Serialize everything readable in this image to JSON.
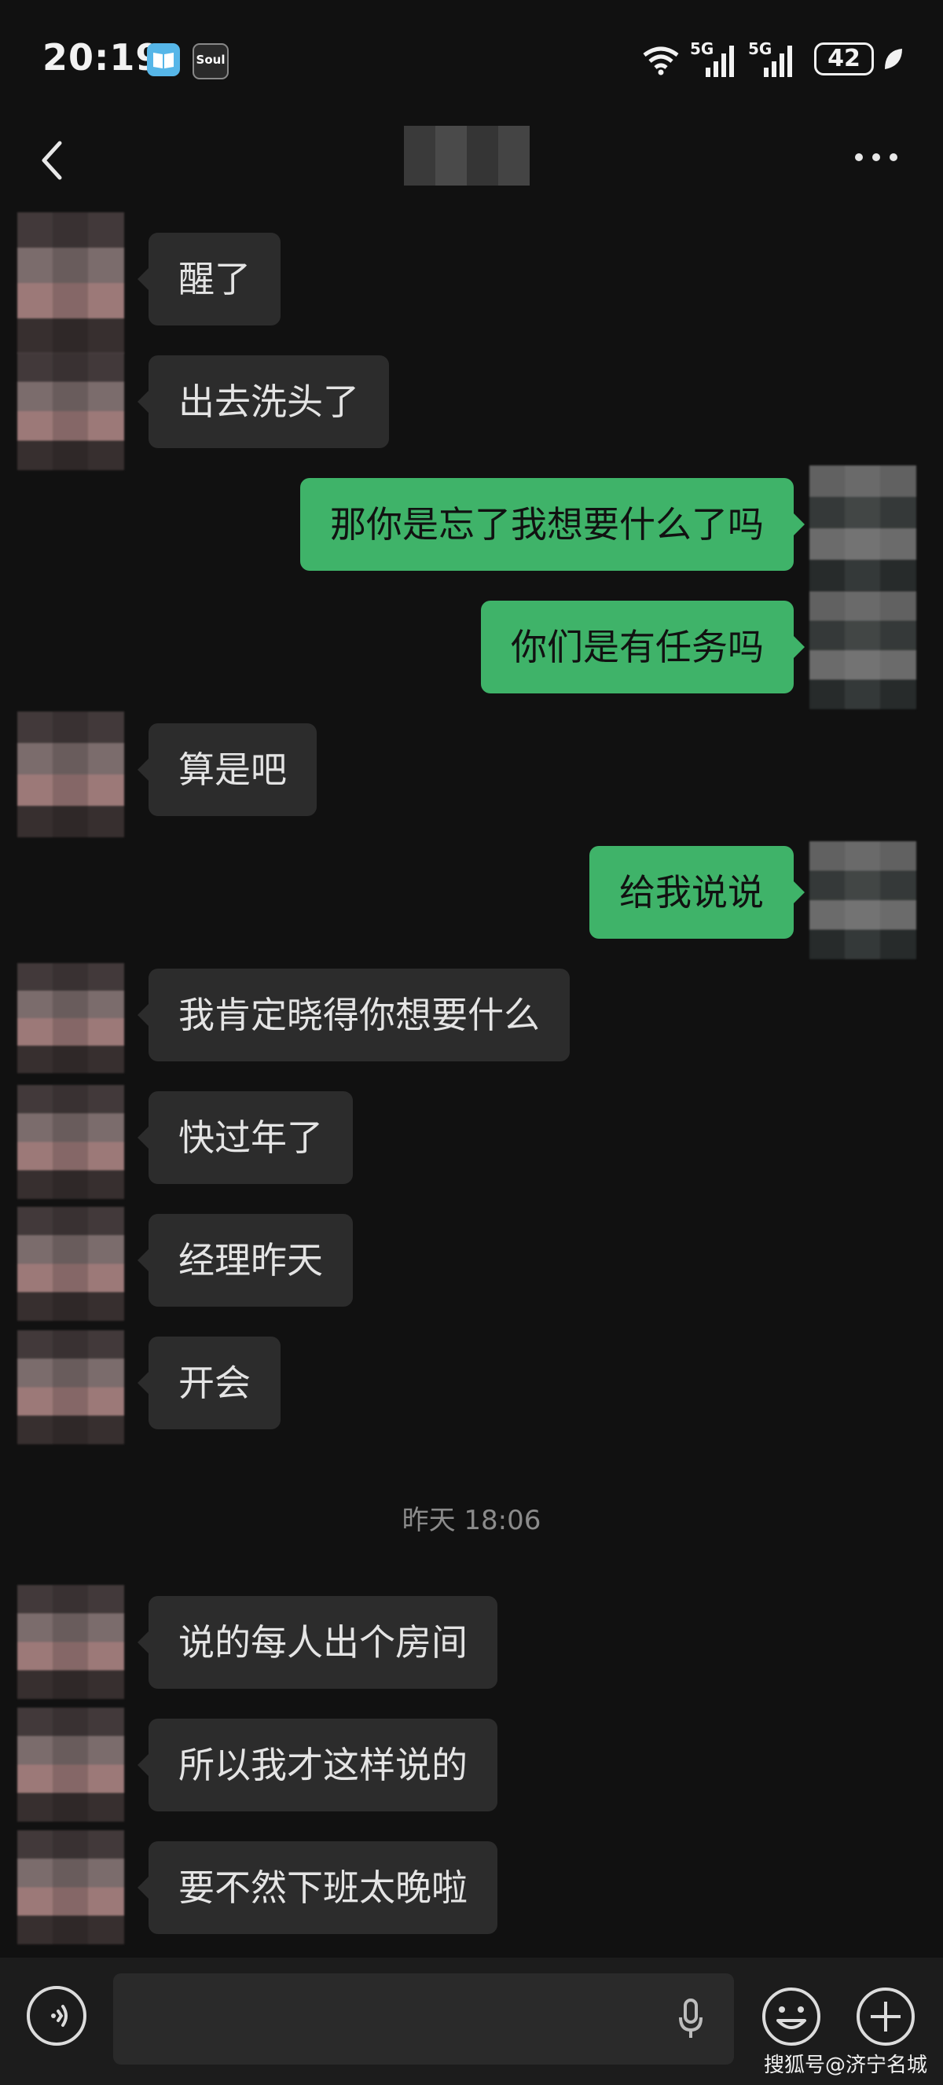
{
  "status_bar": {
    "time": "20:19",
    "soul_app_label": "Soul",
    "network_1": "5G",
    "network_2": "5G",
    "battery": "42"
  },
  "header": {
    "back_icon": "chevron-left-icon",
    "more_icon": "more-dots-icon"
  },
  "messages": [
    {
      "side": "in",
      "text": "醒了"
    },
    {
      "side": "in",
      "text": "出去洗头了"
    },
    {
      "side": "out",
      "text": "那你是忘了我想要什么了吗"
    },
    {
      "side": "out",
      "text": "你们是有任务吗"
    },
    {
      "side": "in",
      "text": "算是吧"
    },
    {
      "side": "out",
      "text": "给我说说"
    },
    {
      "side": "in",
      "text": "我肯定晓得你想要什么"
    },
    {
      "side": "in",
      "text": "快过年了"
    },
    {
      "side": "in",
      "text": "经理昨天"
    },
    {
      "side": "in",
      "text": "开会"
    },
    {
      "side": "in",
      "text": "说的每人出个房间"
    },
    {
      "side": "in",
      "text": "所以我才这样说的"
    },
    {
      "side": "in",
      "text": "要不然下班太晚啦"
    }
  ],
  "timestamp": "昨天 18:06",
  "input_bar": {
    "voice_icon": "voice-toggle-icon",
    "mic_icon": "microphone-icon",
    "emoji_icon": "emoji-icon",
    "plus_icon": "plus-icon"
  },
  "watermark": "搜狐号@济宁名城",
  "colors": {
    "background": "#111111",
    "incoming_bubble": "#2c2c2c",
    "outgoing_bubble": "#3fb369"
  }
}
